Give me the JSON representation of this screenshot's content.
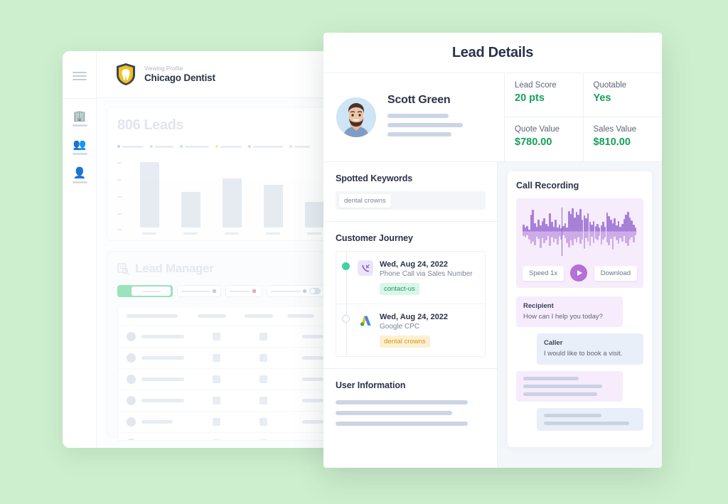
{
  "theme": {
    "page_bg": "#cdefcd",
    "accent_green": "#17a05c",
    "tag_green": "#1c9a63",
    "tag_amber": "#d79516",
    "purple": "#b56fd8",
    "text_dark": "#2b3348",
    "text_muted": "#7b8496"
  },
  "dashboard": {
    "sidebar": {
      "menu_icon": "hamburger-menu-icon",
      "items": [
        {
          "icon": "building-icon"
        },
        {
          "icon": "group-icon"
        },
        {
          "icon": "person-icon"
        }
      ]
    },
    "header": {
      "logo": "shield-tooth-logo",
      "eyebrow": "Viewing Profile",
      "profile_name": "Chicago Dentist"
    },
    "leads_card": {
      "title": "806 Leads",
      "legend_colors": [
        "#6f8fe0",
        "#79bdea",
        "#63cfb4",
        "#f2c85c",
        "#ef8a8a",
        "#b9c1cd"
      ]
    },
    "chart_data": {
      "type": "bar",
      "title": "806 Leads",
      "categories": [
        "",
        "",
        "",
        "",
        ""
      ],
      "values": [
        96,
        52,
        72,
        62,
        38
      ],
      "xlabel": "",
      "ylabel": "",
      "ylim": [
        0,
        100
      ],
      "grid": false,
      "legend_position": "top",
      "note": "Placeholder/blurred bar chart in background dashboard"
    },
    "lead_manager": {
      "title": "Lead Manager",
      "title_icon": "list-search-icon",
      "toolbar": [
        {
          "name": "segmented-toggle",
          "accent": "#8fe0b6"
        },
        {
          "name": "dropdown-filter"
        },
        {
          "name": "status-filter"
        },
        {
          "name": "date-range-toggle"
        }
      ],
      "table": {
        "header_row": true,
        "row_count": 6,
        "columns": 4
      }
    }
  },
  "panel": {
    "title": "Lead Details",
    "lead": {
      "avatar": "user-photo-avatar",
      "name": "Scott Green",
      "masked_line_count": 3
    },
    "metrics": [
      {
        "label": "Lead Score",
        "value": "20 pts"
      },
      {
        "label": "Quotable",
        "value": "Yes"
      },
      {
        "label": "Quote Value",
        "value": "$780.00"
      },
      {
        "label": "Sales Value",
        "value": "$810.00"
      }
    ],
    "spotted_keywords": {
      "heading": "Spotted Keywords",
      "chips": [
        "dental crowns"
      ]
    },
    "customer_journey": {
      "heading": "Customer Journey",
      "items": [
        {
          "dot": "filled",
          "icon": "inbound-phone-call-icon",
          "date": "Wed, Aug 24, 2022",
          "source": "Phone Call via Sales Number",
          "tag": "contact-us",
          "tag_style": "green"
        },
        {
          "dot": "hollow",
          "icon": "google-ads-icon",
          "date": "Wed, Aug 24, 2022",
          "source": "Google CPC",
          "tag": "dental crowns",
          "tag_style": "amber"
        }
      ]
    },
    "user_information": {
      "heading": "User Information",
      "masked_line_count": 3
    },
    "call_recording": {
      "heading": "Call Recording",
      "waveform": [
        18,
        10,
        14,
        6,
        42,
        54,
        22,
        12,
        30,
        16,
        26,
        34,
        20,
        14,
        46,
        24,
        12,
        30,
        10,
        18,
        8,
        14,
        22,
        10,
        52,
        44,
        58,
        36,
        50,
        42,
        56,
        30,
        40,
        34,
        46,
        24,
        18,
        26,
        14,
        20,
        10,
        16,
        24,
        12,
        48,
        38,
        30,
        22,
        34,
        16,
        26,
        12,
        20,
        32,
        42,
        50,
        36,
        28,
        18,
        10
      ],
      "waveform_lower": [
        10,
        14,
        8,
        20,
        30,
        24,
        34,
        12,
        18,
        40,
        16,
        28,
        22,
        10,
        36,
        14,
        26,
        18,
        32,
        12,
        20,
        8,
        16,
        28,
        38,
        22,
        34,
        18,
        26,
        14,
        30,
        20,
        42,
        16,
        24,
        36,
        12,
        28,
        18,
        22,
        10,
        32,
        20,
        14,
        26,
        34,
        18,
        44,
        12,
        22,
        30,
        16,
        24,
        10,
        28,
        36,
        20,
        14,
        26,
        8
      ],
      "playhead_percent": 34,
      "speed_label": "Speed 1x",
      "play_label": "play-button",
      "download_label": "Download"
    },
    "transcript": [
      {
        "side": "left",
        "speaker": "Recipient",
        "message": "How can I help you today?"
      },
      {
        "side": "right",
        "speaker": "Caller",
        "message": "I would like to book a visit."
      },
      {
        "side": "left",
        "masked_lines": [
          60,
          85,
          80
        ]
      },
      {
        "side": "right",
        "masked_lines": [
          62,
          92
        ]
      }
    ]
  }
}
